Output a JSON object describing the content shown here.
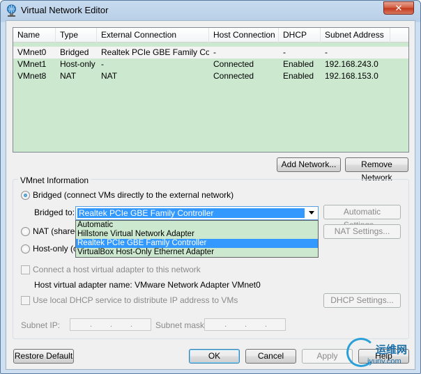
{
  "window": {
    "title": "Virtual Network Editor",
    "close_glyph": "✕"
  },
  "networks": {
    "columns": [
      "Name",
      "Type",
      "External Connection",
      "Host Connection",
      "DHCP",
      "Subnet Address"
    ],
    "rows": [
      [
        "VMnet0",
        "Bridged",
        "Realtek PCIe GBE Family Co...",
        "-",
        "-",
        "-"
      ],
      [
        "VMnet1",
        "Host-only",
        "-",
        "Connected",
        "Enabled",
        "192.168.243.0"
      ],
      [
        "VMnet8",
        "NAT",
        "NAT",
        "Connected",
        "Enabled",
        "192.168.153.0"
      ]
    ],
    "selected_row": 0,
    "add_label": "Add Network...",
    "remove_label": "Remove Network"
  },
  "vmnet_info": {
    "group_label": "VMnet Information",
    "bridged_label": "Bridged (connect VMs directly to the external network)",
    "bridged_selected": true,
    "bridged_to_label": "Bridged to:",
    "bridged_to_value": "Realtek PCIe GBE Family Controller",
    "options": [
      "Automatic",
      "Hillstone Virtual Network Adapter",
      "Realtek PCIe GBE Family Controller",
      "VirtualBox Host-Only Ethernet Adapter"
    ],
    "selected_option": 2,
    "automatic_settings_label": "Automatic Settings...",
    "nat_label": "NAT (shared",
    "nat_settings_label": "NAT Settings...",
    "hostonly_label": "Host-only (co",
    "connect_adapter_label": "Connect a host virtual adapter to this network",
    "adapter_name_label": "Host virtual adapter name: VMware Network Adapter VMnet0",
    "dhcp_label": "Use local DHCP service to distribute IP address to VMs",
    "dhcp_settings_label": "DHCP Settings...",
    "subnet_ip_label": "Subnet IP:",
    "subnet_mask_label": "Subnet mask:",
    "ip_dot": "."
  },
  "footer": {
    "restore_label": "Restore Default",
    "ok_label": "OK",
    "cancel_label": "Cancel",
    "apply_label": "Apply",
    "help_label": "Help"
  },
  "watermark": {
    "cn": "运维网",
    "en": "iyunv.com"
  },
  "colors": {
    "list_bg": "#cce8cf",
    "highlight": "#3399ff",
    "title_bg": "#b9cfe7"
  }
}
